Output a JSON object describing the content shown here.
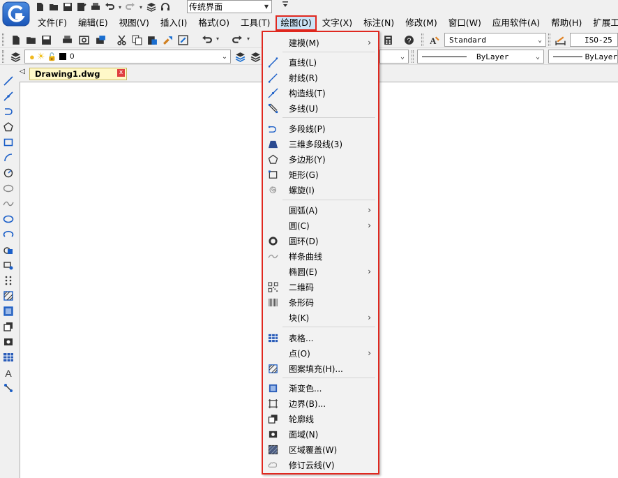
{
  "quick_access": {
    "workspace": "传统界面",
    "more": "₹"
  },
  "menubar": [
    {
      "label": "文件(F)"
    },
    {
      "label": "编辑(E)"
    },
    {
      "label": "视图(V)"
    },
    {
      "label": "插入(I)"
    },
    {
      "label": "格式(O)"
    },
    {
      "label": "工具(T)"
    },
    {
      "label": "绘图(D)"
    },
    {
      "label": "文字(X)"
    },
    {
      "label": "标注(N)"
    },
    {
      "label": "修改(M)"
    },
    {
      "label": "窗口(W)"
    },
    {
      "label": "应用软件(A)"
    },
    {
      "label": "帮助(H)"
    },
    {
      "label": "扩展工具(S)"
    }
  ],
  "toolbar": {
    "text_style": "Standard",
    "dim_style": "ISO-25",
    "layer": "0",
    "linetype": "ByLayer",
    "lineweight": "ByLayer"
  },
  "tab": {
    "document": "Drawing1.dwg",
    "close": "x",
    "scroll_left": "◁"
  },
  "draw_menu": {
    "items": [
      {
        "label": "建模(M)",
        "icon": "none",
        "submenu": true
      },
      {
        "label": "直线(L)",
        "icon": "line-icon"
      },
      {
        "label": "射线(R)",
        "icon": "ray-icon"
      },
      {
        "label": "构造线(T)",
        "icon": "xline-icon"
      },
      {
        "label": "多线(U)",
        "icon": "multiline-icon"
      },
      {
        "label": "多段线(P)",
        "icon": "polyline-icon"
      },
      {
        "label": "三维多段线(3)",
        "icon": "3d-polyline-icon"
      },
      {
        "label": "多边形(Y)",
        "icon": "polygon-icon"
      },
      {
        "label": "矩形(G)",
        "icon": "rectangle-icon"
      },
      {
        "label": "螺旋(I)",
        "icon": "helix-icon"
      },
      {
        "label": "圆弧(A)",
        "icon": "none",
        "submenu": true
      },
      {
        "label": "圆(C)",
        "icon": "none",
        "submenu": true
      },
      {
        "label": "圆环(D)",
        "icon": "donut-icon"
      },
      {
        "label": "样条曲线",
        "icon": "spline-icon"
      },
      {
        "label": "椭圆(E)",
        "icon": "none",
        "submenu": true
      },
      {
        "label": "二维码",
        "icon": "qrcode-icon"
      },
      {
        "label": "条形码",
        "icon": "barcode-icon"
      },
      {
        "label": "块(K)",
        "icon": "none",
        "submenu": true
      },
      {
        "label": "表格...",
        "icon": "table-icon"
      },
      {
        "label": "点(O)",
        "icon": "none",
        "submenu": true
      },
      {
        "label": "图案填充(H)...",
        "icon": "hatch-icon"
      },
      {
        "label": "渐变色...",
        "icon": "gradient-icon"
      },
      {
        "label": "边界(B)...",
        "icon": "boundary-icon"
      },
      {
        "label": "轮廓线",
        "icon": "outline-icon"
      },
      {
        "label": "面域(N)",
        "icon": "region-icon"
      },
      {
        "label": "区域覆盖(W)",
        "icon": "wipeout-icon"
      },
      {
        "label": "修订云线(V)",
        "icon": "revcloud-icon"
      }
    ],
    "submenu_arrow": "›"
  }
}
